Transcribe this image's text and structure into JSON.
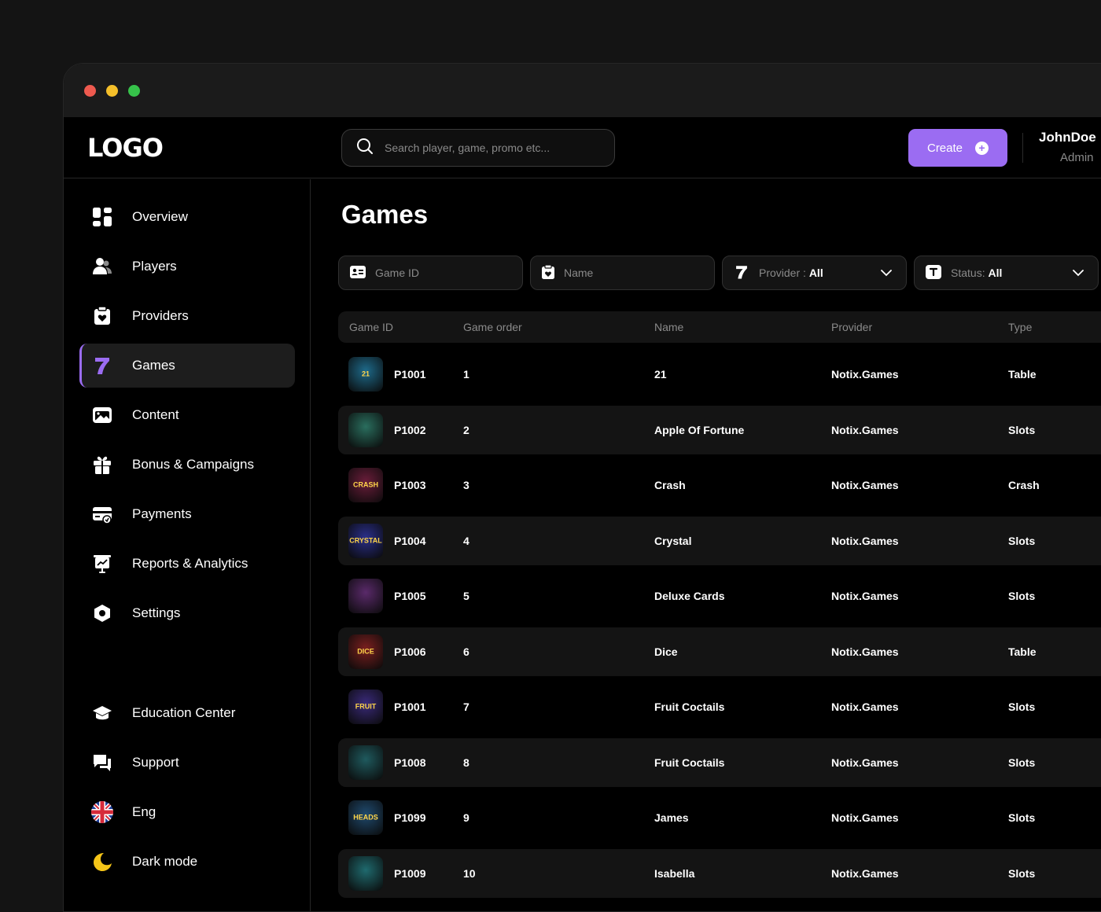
{
  "header": {
    "logo": "LOGO",
    "search_placeholder": "Search player, game, promo etc...",
    "create_label": "Create",
    "user_name": "JohnDoe",
    "user_role": "Admin"
  },
  "sidebar": {
    "items": [
      {
        "label": "Overview",
        "icon": "overview-icon"
      },
      {
        "label": "Players",
        "icon": "players-icon"
      },
      {
        "label": "Providers",
        "icon": "providers-icon"
      },
      {
        "label": "Games",
        "icon": "games-icon",
        "active": true
      },
      {
        "label": "Content",
        "icon": "content-icon"
      },
      {
        "label": "Bonus & Campaigns",
        "icon": "gift-icon"
      },
      {
        "label": "Payments",
        "icon": "payments-icon"
      },
      {
        "label": "Reports & Analytics",
        "icon": "reports-icon"
      },
      {
        "label": "Settings",
        "icon": "settings-icon"
      }
    ],
    "bottom_items": [
      {
        "label": "Education Center",
        "icon": "graduation-cap-icon"
      },
      {
        "label": "Support",
        "icon": "chat-icon"
      },
      {
        "label": "Eng",
        "icon": "uk-flag-icon"
      },
      {
        "label": "Dark mode",
        "icon": "moon-icon"
      }
    ]
  },
  "main": {
    "title": "Games",
    "filters": {
      "game_id_placeholder": "Game ID",
      "name_placeholder": "Name",
      "provider_label": "Provider : ",
      "provider_value": "All",
      "status_label": "Status: ",
      "status_value": "All"
    },
    "table": {
      "columns": [
        "Game ID",
        "Game order",
        "Name",
        "Provider",
        "Type"
      ],
      "rows": [
        {
          "id": "P1001",
          "order": "1",
          "name": "21",
          "provider": "Notix.Games",
          "type": "Table",
          "thumb": "21",
          "color": "#1e6a8a"
        },
        {
          "id": "P1002",
          "order": "2",
          "name": "Apple Of Fortune",
          "provider": "Notix.Games",
          "type": "Slots",
          "thumb": "",
          "color": "#2a6e5e"
        },
        {
          "id": "P1003",
          "order": "3",
          "name": "Crash",
          "provider": "Notix.Games",
          "type": "Crash",
          "thumb": "CRASH",
          "color": "#6a1d3a"
        },
        {
          "id": "P1004",
          "order": "4",
          "name": "Crystal",
          "provider": "Notix.Games",
          "type": "Slots",
          "thumb": "CRYSTAL",
          "color": "#2a2f8a"
        },
        {
          "id": "P1005",
          "order": "5",
          "name": "Deluxe Cards",
          "provider": "Notix.Games",
          "type": "Slots",
          "thumb": "",
          "color": "#5a2a6a"
        },
        {
          "id": "P1006",
          "order": "6",
          "name": "Dice",
          "provider": "Notix.Games",
          "type": "Table",
          "thumb": "DICE",
          "color": "#7a1f1f"
        },
        {
          "id": "P1001",
          "order": "7",
          "name": "Fruit Coctails",
          "provider": "Notix.Games",
          "type": "Slots",
          "thumb": "FRUIT",
          "color": "#3a2a7a"
        },
        {
          "id": "P1008",
          "order": "8",
          "name": "Fruit Coctails",
          "provider": "Notix.Games",
          "type": "Slots",
          "thumb": "",
          "color": "#1f5a5e"
        },
        {
          "id": "P1099",
          "order": "9",
          "name": "James",
          "provider": "Notix.Games",
          "type": "Slots",
          "thumb": "HEADS",
          "color": "#1f4a6e"
        },
        {
          "id": "P1009",
          "order": "10",
          "name": "Isabella",
          "provider": "Notix.Games",
          "type": "Slots",
          "thumb": "",
          "color": "#1f6a6e"
        }
      ]
    }
  },
  "colors": {
    "accent": "#9b6cf2",
    "background": "#000000",
    "row_alt": "#141414"
  }
}
